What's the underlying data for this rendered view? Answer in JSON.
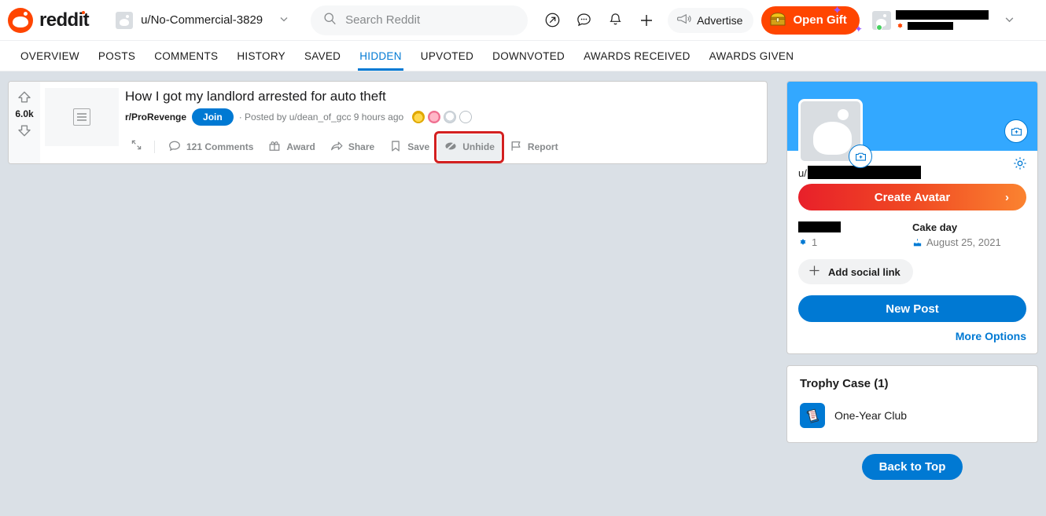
{
  "header": {
    "brand": "reddit",
    "brand_icon": "reddit-logo-icon",
    "user_switcher": {
      "label": "u/No-Commercial-3829",
      "chevron": "⌄"
    },
    "search": {
      "placeholder": "Search Reddit",
      "value": "",
      "icon": "search-icon"
    },
    "icons": [
      {
        "name": "popular-arrow-icon",
        "glyph": "↗"
      },
      {
        "name": "chat-icon",
        "glyph": "…"
      },
      {
        "name": "notifications-bell-icon",
        "glyph": "•"
      },
      {
        "name": "create-post-plus-icon",
        "glyph": "+"
      }
    ],
    "advertise": {
      "label": "Advertise",
      "icon": "megaphone-icon"
    },
    "gift": {
      "label": "Open Gift",
      "icon": "treasure-chest-icon",
      "color": "#ff4500"
    },
    "account_chevron": "⌄"
  },
  "tabs": [
    {
      "label": "OVERVIEW",
      "active": false
    },
    {
      "label": "POSTS",
      "active": false
    },
    {
      "label": "COMMENTS",
      "active": false
    },
    {
      "label": "HISTORY",
      "active": false
    },
    {
      "label": "SAVED",
      "active": false
    },
    {
      "label": "HIDDEN",
      "active": true
    },
    {
      "label": "UPVOTED",
      "active": false
    },
    {
      "label": "DOWNVOTED",
      "active": false
    },
    {
      "label": "AWARDS RECEIVED",
      "active": false
    },
    {
      "label": "AWARDS GIVEN",
      "active": false
    }
  ],
  "post": {
    "score": "6.0k",
    "upvote_icon": "upvote-arrow-icon",
    "downvote_icon": "downvote-arrow-icon",
    "thumbnail_icon": "text-post-icon",
    "title": "How I got my landlord arrested for auto theft",
    "subreddit": "r/ProRevenge",
    "join_label": "Join",
    "byline": "· Posted by u/dean_of_gcc 9 hours ago",
    "awards": [
      {
        "name": "gold-award-badge",
        "color": "#f5c518"
      },
      {
        "name": "pink-award-badge",
        "color": "#f07896"
      },
      {
        "name": "silver-award-badge",
        "color": "#e8eaed"
      },
      {
        "name": "wholesome-award-badge",
        "color": "#ffffff"
      }
    ],
    "actions": [
      {
        "name": "expand-post-icon",
        "label": "",
        "icon": "expand-arrows-icon",
        "highlighted": false
      },
      {
        "name": "comments-button",
        "label": "121 Comments",
        "icon": "comment-bubble-icon",
        "highlighted": false
      },
      {
        "name": "award-button",
        "label": "Award",
        "icon": "award-gift-icon",
        "highlighted": false
      },
      {
        "name": "share-button",
        "label": "Share",
        "icon": "share-arrow-icon",
        "highlighted": false
      },
      {
        "name": "save-button",
        "label": "Save",
        "icon": "bookmark-icon",
        "highlighted": false
      },
      {
        "name": "unhide-button",
        "label": "Unhide",
        "icon": "eye-slash-icon",
        "highlighted": true
      },
      {
        "name": "report-button",
        "label": "Report",
        "icon": "flag-icon",
        "highlighted": false
      }
    ],
    "highlight_color": "#d32020"
  },
  "sidebar": {
    "banner_color": "#33a8ff",
    "banner_camera_icon": "camera-plus-icon",
    "avatar_camera_icon": "camera-plus-icon",
    "avatar_icon": "reddit-snoo-avatar",
    "settings_icon": "gear-icon",
    "username_prefix": "u/",
    "username_redacted": true,
    "create_avatar": {
      "label": "Create Avatar",
      "chevron": "›"
    },
    "stats": [
      {
        "label_redacted": true,
        "label": "",
        "value": "1",
        "icon": "karma-icon",
        "name": "karma-stat"
      },
      {
        "label": "Cake day",
        "value": "August 25, 2021",
        "icon": "cake-icon",
        "name": "cake-day-stat"
      }
    ],
    "add_social": {
      "label": "Add social link",
      "icon": "plus-icon"
    },
    "new_post_label": "New Post",
    "more_options_label": "More Options",
    "trophy_case": {
      "title": "Trophy Case (1)",
      "trophies": [
        {
          "name": "One-Year Club",
          "icon": "one-year-club-trophy-icon"
        }
      ]
    },
    "back_to_top_label": "Back to Top"
  }
}
